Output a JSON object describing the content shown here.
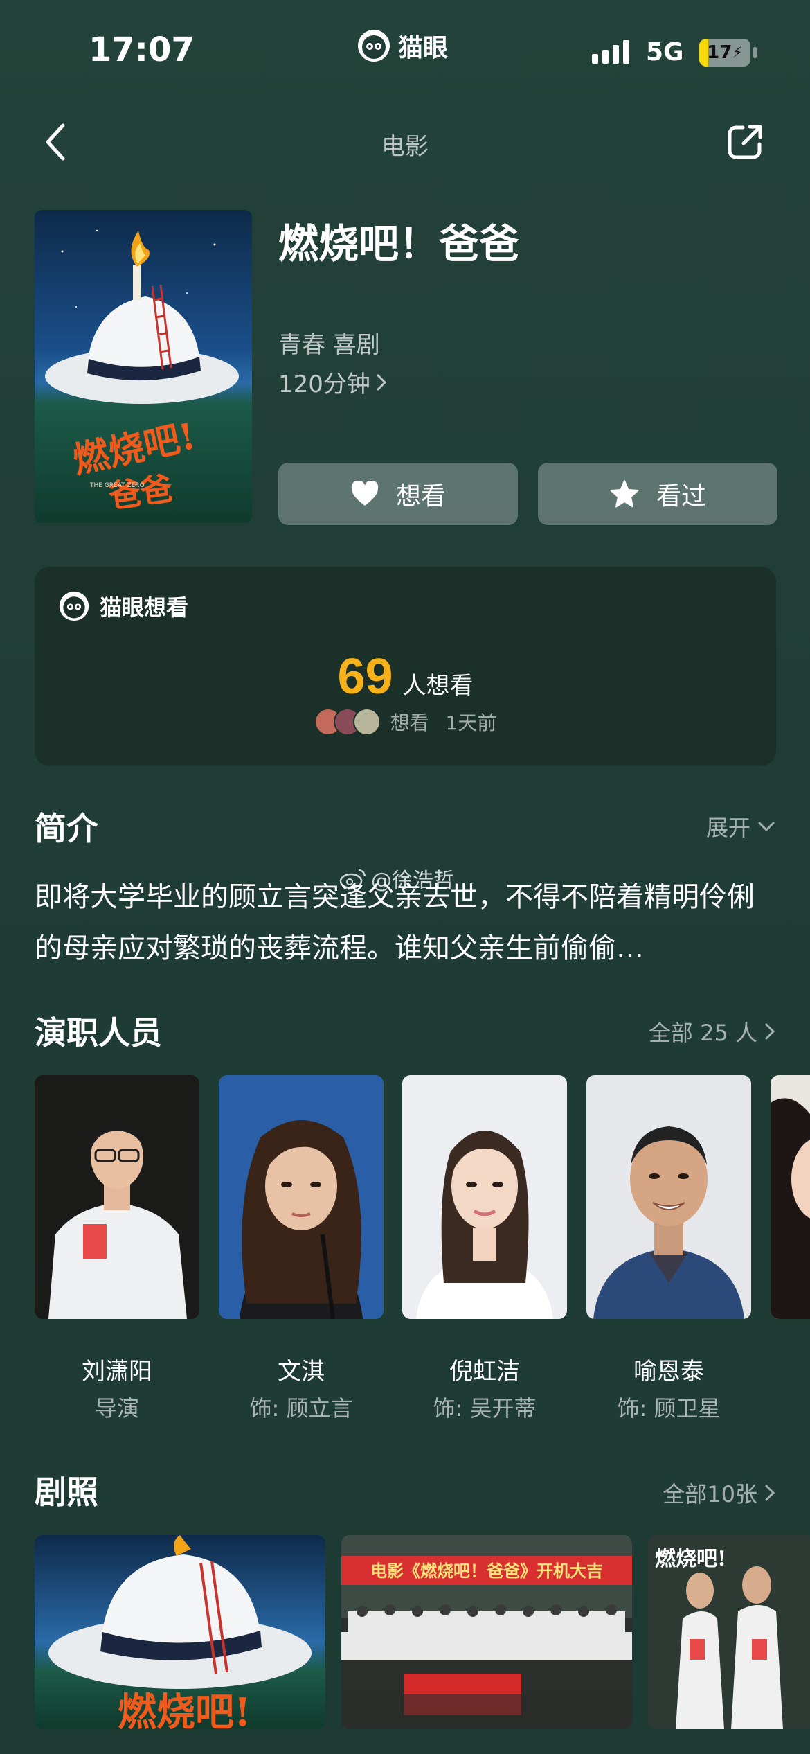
{
  "status_bar": {
    "time": "17:07",
    "app_logo_text": "猫眼",
    "network": "5G",
    "battery": "17",
    "battery_level": 0.17
  },
  "nav": {
    "title": "电影",
    "back_icon": "chevron-left-icon",
    "share_icon": "share-icon"
  },
  "movie": {
    "title": "燃烧吧！爸爸",
    "genres": "青春 喜剧",
    "duration": "120分钟",
    "poster_title_art": "燃烧吧！爸爸",
    "poster_subtitle_art": "THE GREAT ZERO"
  },
  "actions": {
    "want_label": "想看",
    "seen_label": "看过"
  },
  "want_card": {
    "header": "猫眼想看",
    "count": "69",
    "count_label": "人想看",
    "recent_action": "想看",
    "recent_time": "1天前"
  },
  "synopsis": {
    "title": "简介",
    "expand_label": "展开",
    "text": "即将大学毕业的顾立言突逢父亲去世，不得不陪着精明伶俐的母亲应对繁琐的丧葬流程。谁知父亲生前偷偷…",
    "watermark": "@徐浩哲"
  },
  "cast": {
    "title": "演职人员",
    "more_label": "全部 25 人",
    "members": [
      {
        "name": "刘潇阳",
        "role": "导演"
      },
      {
        "name": "文淇",
        "role": "饰: 顾立言"
      },
      {
        "name": "倪虹洁",
        "role": "饰: 吴开蒂"
      },
      {
        "name": "喻恩泰",
        "role": "饰: 顾卫星"
      }
    ]
  },
  "stills": {
    "title": "剧照",
    "more_label": "全部10张",
    "banner_text": "电影《燃烧吧！爸爸》开机大吉"
  },
  "colors": {
    "background": "#1f3d35",
    "card": "#1a3029",
    "accent_count": "#f7b21b",
    "battery": "#f5d70a"
  }
}
